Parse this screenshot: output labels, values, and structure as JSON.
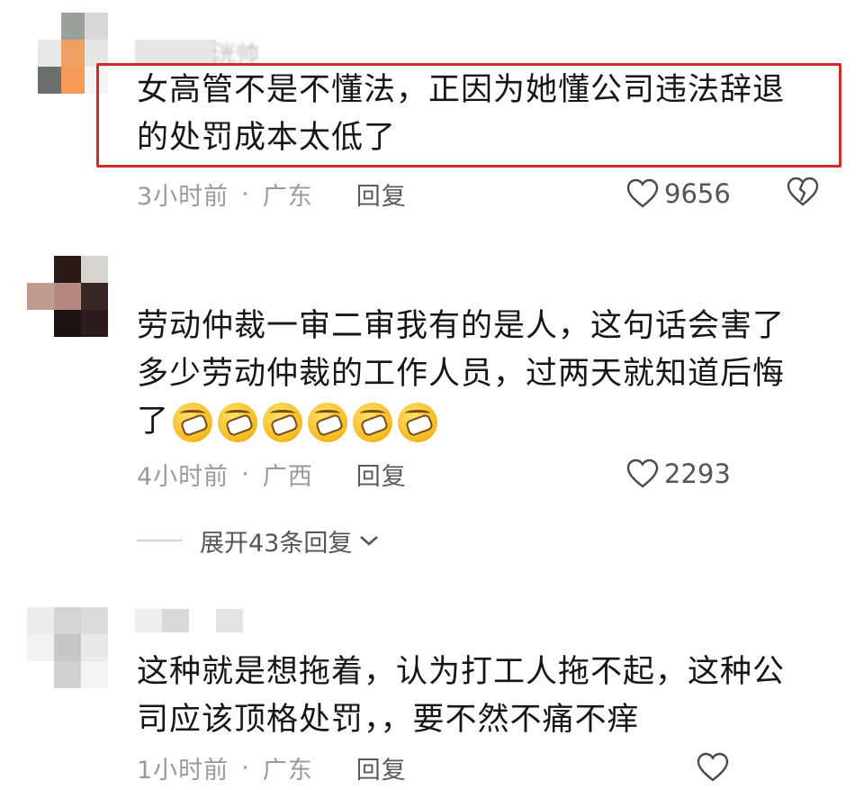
{
  "comments": [
    {
      "username": "洸帅",
      "text_lines": [
        "女高管不是不懂法，正因为她懂公司违法辞退",
        "的处罚成本太低了"
      ],
      "time": "3小时前",
      "location": "广东",
      "reply_label": "回复",
      "likes": "9656",
      "has_dislike": true
    },
    {
      "text_lines": [
        "劳动仲裁一审二审我有的是人，这句话会害了",
        "多少劳动仲裁的工作人员，过两天就知道后悔",
        "了"
      ],
      "emoji_count": 6,
      "time": "4小时前",
      "location": "广西",
      "reply_label": "回复",
      "likes": "2293"
    },
    {
      "text_lines": [
        "这种就是想拖着，认为打工人拖不起，这种公",
        "司应该顶格处罚，，要不然不痛不痒"
      ],
      "time": "1小时前",
      "location": "广东",
      "reply_label": "回复",
      "likes": ""
    }
  ],
  "expand_replies": "展开43条回复",
  "separator": "·",
  "colors": {
    "highlight_border": "#d42a2a",
    "meta_text": "#9a9a9a",
    "body_text": "#161616"
  }
}
